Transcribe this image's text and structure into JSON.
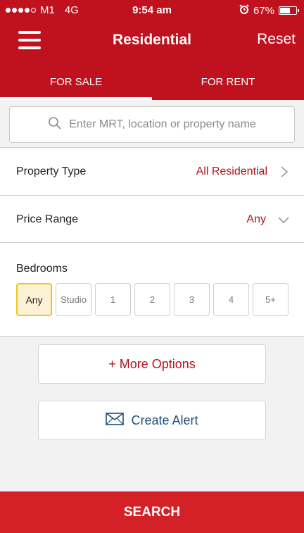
{
  "status": {
    "carrier": "M1",
    "network": "4G",
    "time": "9:54 am",
    "battery": "67%",
    "battery_level": 0.67
  },
  "nav": {
    "title": "Residential",
    "reset": "Reset"
  },
  "tabs": [
    {
      "label": "FOR SALE",
      "active": true
    },
    {
      "label": "FOR RENT",
      "active": false
    }
  ],
  "search": {
    "placeholder": "Enter MRT, location or property name"
  },
  "property_type": {
    "label": "Property Type",
    "value": "All Residential"
  },
  "price_range": {
    "label": "Price Range",
    "value": "Any"
  },
  "bedrooms": {
    "label": "Bedrooms",
    "options": [
      "Any",
      "Studio",
      "1",
      "2",
      "3",
      "4",
      "5+"
    ],
    "selected": "Any"
  },
  "more_options": "+ More Options",
  "create_alert": "Create Alert",
  "search_button": "SEARCH",
  "colors": {
    "brand_red": "#c0111f",
    "accent_red": "#b5121b",
    "selected_yellow": "#f3c320",
    "alert_blue": "#1f4e79"
  }
}
